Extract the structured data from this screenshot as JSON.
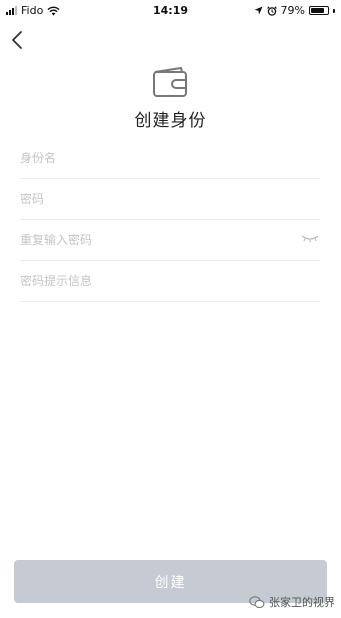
{
  "status_bar": {
    "carrier": "Fido",
    "time": "14:19",
    "battery_text": "79%",
    "battery_level": 0.79
  },
  "header": {
    "title": "创建身份"
  },
  "form": {
    "identity_name_placeholder": "身份名",
    "password_placeholder": "密码",
    "repeat_password_placeholder": "重复输入密码",
    "password_hint_placeholder": "密码提示信息"
  },
  "actions": {
    "create_label": "创建"
  },
  "watermark": {
    "text": "张家卫的视界"
  },
  "colors": {
    "button_disabled": "#c6cad3",
    "divider": "#ececec",
    "placeholder": "#c4c4c4"
  }
}
